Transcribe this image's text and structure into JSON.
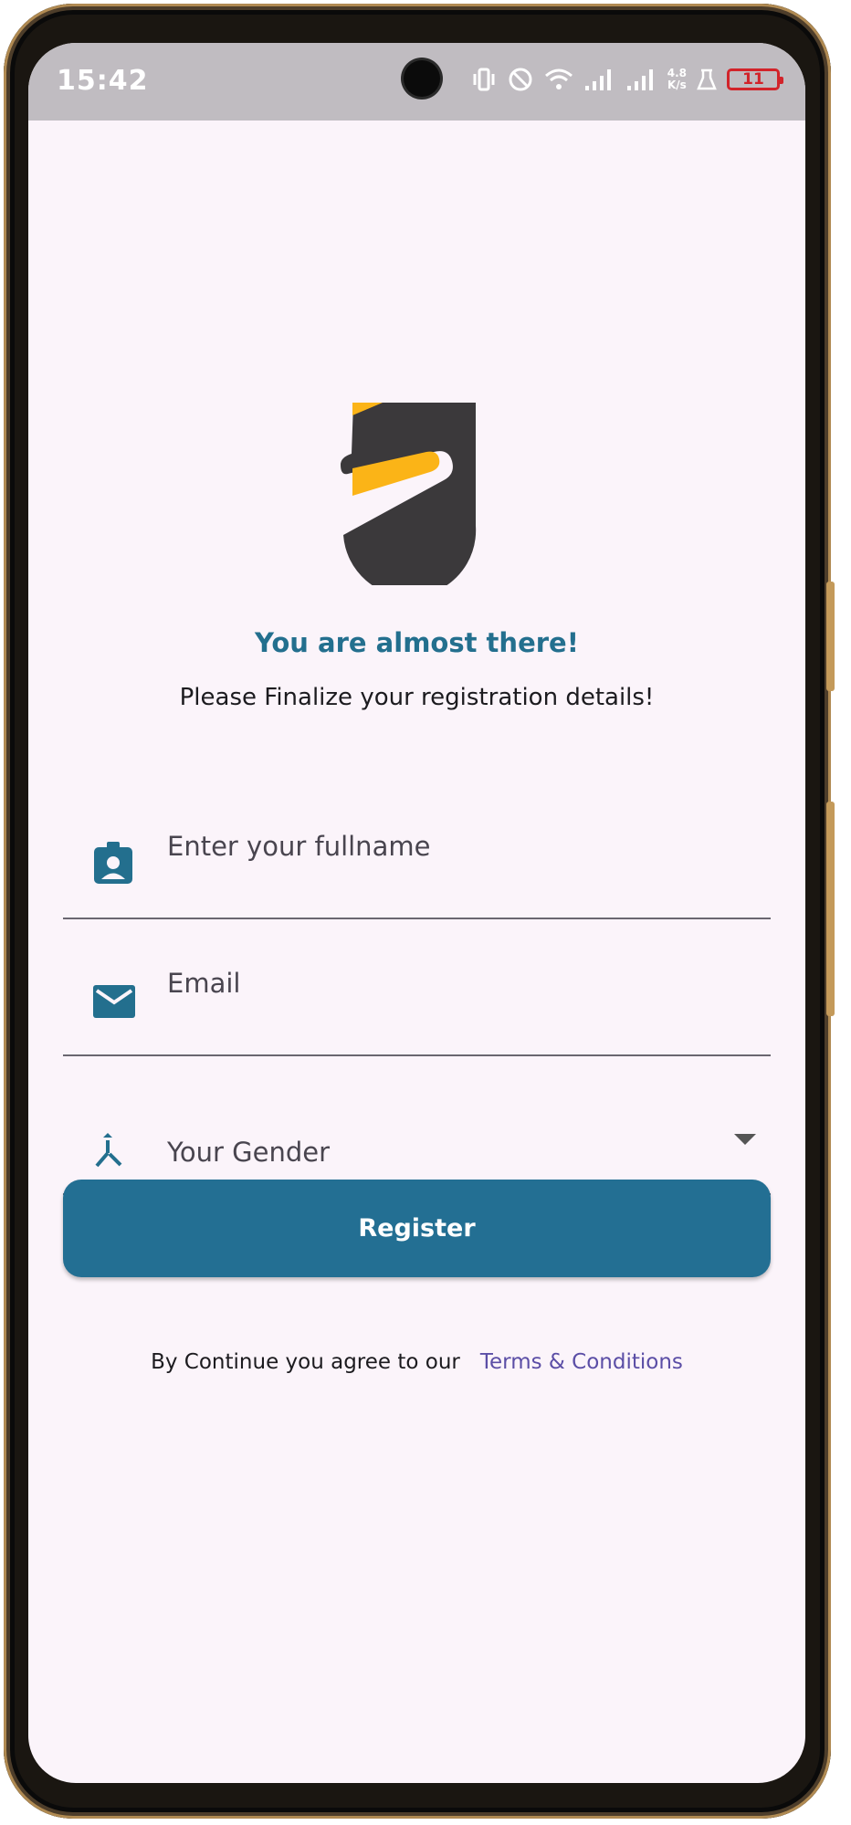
{
  "status_bar": {
    "time": "15:42",
    "network_speed_value": "4.8",
    "network_speed_unit": "K/s",
    "battery_level": "11",
    "icons": [
      "vibrate-icon",
      "do-not-disturb-icon",
      "wifi-icon",
      "signal-icon",
      "signal-icon",
      "lab-icon",
      "battery-icon"
    ],
    "battery_color": "#d2232a"
  },
  "brand": {
    "logo": "app-logo",
    "logo_colors": {
      "dark": "#3b393b",
      "accent": "#fbb417"
    }
  },
  "header": {
    "title": "You are almost there!",
    "subtitle": "Please Finalize your registration details!"
  },
  "form": {
    "fullname": {
      "placeholder": "Enter your fullname",
      "icon": "badge-icon"
    },
    "email": {
      "placeholder": "Email",
      "icon": "mail-icon"
    },
    "gender": {
      "placeholder": "Your Gender",
      "icon": "merge-icon",
      "dropdown_icon": "caret-down-icon"
    }
  },
  "actions": {
    "register_label": "Register",
    "register_color": "#236f93"
  },
  "footer": {
    "agreement_text": "By Continue you agree to our",
    "terms_link": "Terms & Conditions"
  }
}
